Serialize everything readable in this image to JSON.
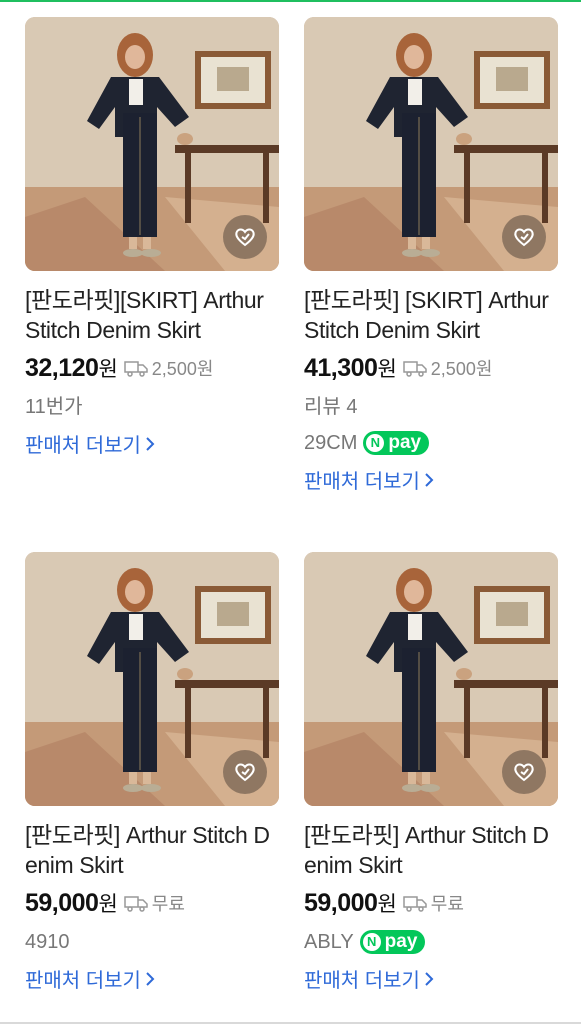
{
  "products": [
    {
      "title": "[판도라핏][SKIRT] Arthur Stitch Denim Skirt",
      "price": "32,120",
      "currency": "원",
      "shipping": "2,500원",
      "meta": "11번가",
      "npay": false,
      "more_label": "판매처 더보기"
    },
    {
      "title": "[판도라핏] [SKIRT] Arthur Stitch Denim Skirt",
      "price": "41,300",
      "currency": "원",
      "shipping": "2,500원",
      "review": "리뷰 4",
      "meta": "29CM",
      "npay": true,
      "more_label": "판매처 더보기"
    },
    {
      "title": "[판도라핏] Arthur Stitch Denim Skirt",
      "price": "59,000",
      "currency": "원",
      "shipping": "무료",
      "meta": "4910",
      "npay": false,
      "more_label": "판매처 더보기"
    },
    {
      "title": "[판도라핏] Arthur Stitch Denim Skirt",
      "price": "59,000",
      "currency": "원",
      "shipping": "무료",
      "meta": "ABLY",
      "npay": true,
      "more_label": "판매처 더보기"
    }
  ],
  "npay_label": "pay",
  "npay_n": "N",
  "icons": {
    "wish": "heart-outline-icon",
    "shipping": "truck-icon",
    "more": "chevron-right-icon"
  },
  "colors": {
    "accent_green": "#1fbf5f",
    "npay_green": "#03c75a",
    "link_blue": "#2f6ad8"
  }
}
